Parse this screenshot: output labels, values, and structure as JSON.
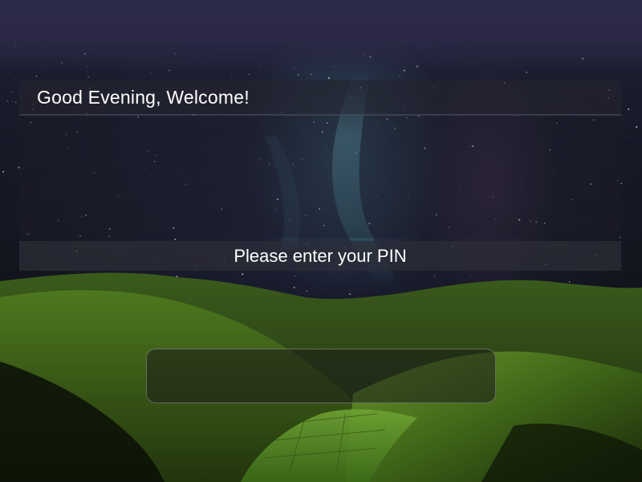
{
  "login": {
    "greeting": "Good Evening, Welcome!",
    "prompt": "Please enter your PIN",
    "pin_value": "",
    "pin_placeholder": ""
  },
  "background": {
    "scene": "night sky with aurora over green hills",
    "sky_color": "#1a1b2c",
    "hill_color": "#4f7a1e"
  }
}
